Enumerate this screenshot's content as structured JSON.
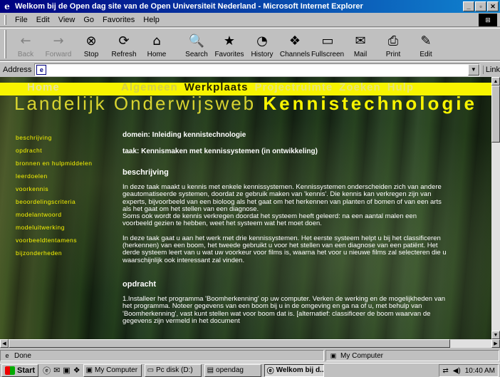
{
  "window": {
    "title": "Welkom bij de Open dag site van de Open Universiteit Nederland - Microsoft Internet Explorer",
    "icon": "ie-icon",
    "controls": [
      "minimize",
      "maximize",
      "close"
    ]
  },
  "menu": [
    "File",
    "Edit",
    "View",
    "Go",
    "Favorites",
    "Help"
  ],
  "toolbar": [
    {
      "label": "Back",
      "icon": "←",
      "enabled": false
    },
    {
      "label": "Forward",
      "icon": "→",
      "enabled": false
    },
    {
      "label": "Stop",
      "icon": "⊗",
      "enabled": true
    },
    {
      "label": "Refresh",
      "icon": "⟳",
      "enabled": true
    },
    {
      "label": "Home",
      "icon": "⌂",
      "enabled": true
    },
    {
      "label": "Search",
      "icon": "🔍",
      "enabled": true
    },
    {
      "label": "Favorites",
      "icon": "★",
      "enabled": true
    },
    {
      "label": "History",
      "icon": "◔",
      "enabled": true
    },
    {
      "label": "Channels",
      "icon": "❖",
      "enabled": true
    },
    {
      "label": "Fullscreen",
      "icon": "▭",
      "enabled": true
    },
    {
      "label": "Mail",
      "icon": "✉",
      "enabled": true
    },
    {
      "label": "Print",
      "icon": "⎙",
      "enabled": true
    },
    {
      "label": "Edit",
      "icon": "✎",
      "enabled": true
    }
  ],
  "address": {
    "label": "Address",
    "value": "",
    "links_label": "Link"
  },
  "page": {
    "nav_home": "Home",
    "nav_items": [
      {
        "label": "Algemeen",
        "state": "dim"
      },
      {
        "label": "Werkplaats",
        "state": "active"
      },
      {
        "label": "Projectruimte",
        "state": "faint"
      },
      {
        "label": "Zoeken",
        "state": "faint"
      },
      {
        "label": "Hulp",
        "state": "faint"
      }
    ],
    "title_thin": "Landelijk Onderwijsweb",
    "title_bold": "Kennistechnologie",
    "side_nav": [
      "beschrijving",
      "opdracht",
      "bronnen en hulpmiddelen",
      "leerdoelen",
      "voorkennis",
      "beoordelingscriteria",
      "modelantwoord",
      "modeluitwerking",
      "voorbeeldtentamens",
      "bijzonderheden"
    ],
    "domain": "domein: Inleiding kennistechnologie",
    "task": "taak: Kennismaken met kennissystemen (in ontwikkeling)",
    "section1_heading": "beschrijving",
    "section1_p1": "In deze taak maakt u kennis met enkele kennissystemen. Kennissystemen onderscheiden zich van andere geautomatiseerde systemen, doordat ze gebruik maken van 'kennis'. Die kennis kan verkregen zijn van experts, bijvoorbeeld van een bioloog als het gaat om het herkennen van planten of bomen of van een arts als het gaat om het stellen van een diagnose.",
    "section1_p2": "Soms ook wordt de kennis verkregen doordat het systeem heeft geleerd: na een aantal malen een voorbeeld gezien te hebben, weet het systeem wat het moet doen.",
    "section1_p3": "In deze taak gaat u aan het werk met drie kennissystemen. Het eerste systeem helpt u bij het classificeren (herkennen) van een boom, het tweede gebruikt u voor het stellen van een diagnose van een patiënt. Het derde systeem leert van u wat uw voorkeur voor films is, waarna het voor u nieuwe films zal selecteren die u waarschijnlijk ook interessant zal vinden.",
    "section2_heading": "opdracht",
    "section2_p1": "1.Installeer het programma 'Boomherkenning' op uw computer. Verken de werking en de mogelijkheden van het programma. Noteer gegevens van een boom bij u in de omgeving en ga na of u, met behulp van 'Boomherkenning', vast kunt stellen wat voor boom dat is. [alternatief: classificeer de boom waarvan de gegevens zijn vermeld in het document"
  },
  "status": {
    "text": "Done",
    "zone": "My Computer"
  },
  "taskbar": {
    "start_label": "Start",
    "tasks": [
      {
        "label": "My Computer",
        "active": false
      },
      {
        "label": "Pc disk (D:)",
        "active": false
      },
      {
        "label": "opendag",
        "active": false
      },
      {
        "label": "Welkom bij d...",
        "active": true
      }
    ],
    "clock": "10:40 AM"
  },
  "colors": {
    "accent_yellow": "#f8f400",
    "title_bar": "#000080",
    "chrome": "#c0c0c0"
  }
}
